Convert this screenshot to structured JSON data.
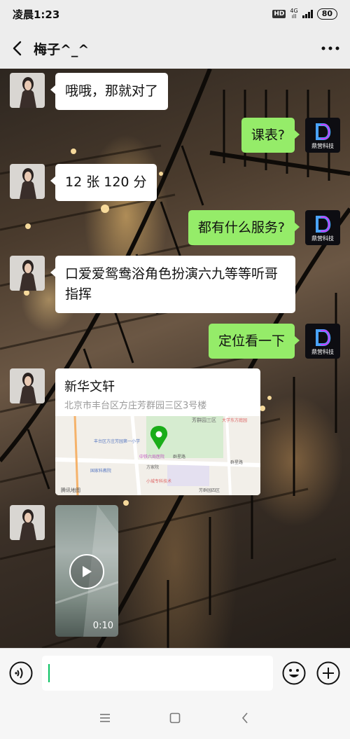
{
  "status": {
    "time": "凌晨1:23",
    "hd": "HD",
    "network": "4G",
    "network_sub": "ıll",
    "battery": "80"
  },
  "header": {
    "title": "梅子^_^"
  },
  "messages": [
    {
      "side": "left",
      "text": "哦哦，那就对了"
    },
    {
      "side": "right",
      "text": "课表?"
    },
    {
      "side": "left",
      "text": "12 张 120 分"
    },
    {
      "side": "right",
      "text": "都有什么服务?"
    },
    {
      "side": "left",
      "text": "口爱爱鸳鸯浴角色扮演六九等等听哥指挥"
    },
    {
      "side": "right",
      "text": "定位看一下"
    }
  ],
  "sender_logo": {
    "name": "鼎营科技",
    "sub": "DAXY·DEAN"
  },
  "location": {
    "name": "新华文轩",
    "address": "北京市丰台区方庄芳群园三区3号楼",
    "map_labels": [
      "芳群园三区",
      "大学东方庭园",
      "丰台区方庄芳园第一小学",
      "中铁六局医院",
      "方家院",
      "国家科教院",
      "小城专科技术",
      "芳群园四区",
      "群星路",
      "群星路",
      "腾讯地图"
    ]
  },
  "video": {
    "duration": "0:10"
  },
  "input": {
    "placeholder": ""
  },
  "colors": {
    "sent_bubble": "#95ec69",
    "received_bubble": "#ffffff",
    "accent": "#07c160",
    "pin": "#1aad19"
  }
}
